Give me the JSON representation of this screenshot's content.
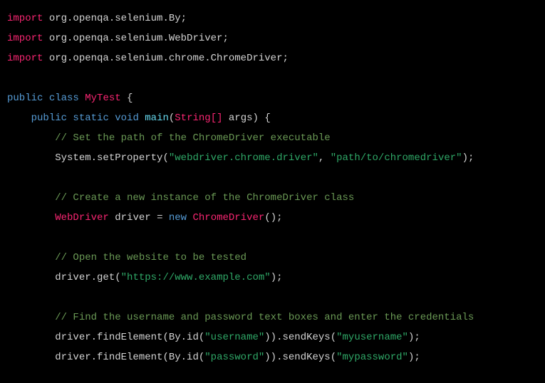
{
  "code": {
    "line1": {
      "import": "import",
      "pkg": " org.openqa.selenium.By;"
    },
    "line2": {
      "import": "import",
      "pkg": " org.openqa.selenium.WebDriver;"
    },
    "line3": {
      "import": "import",
      "pkg": " org.openqa.selenium.chrome.ChromeDriver;"
    },
    "line5": {
      "public": "public",
      "class": " class ",
      "name": "MyTest",
      "brace": " {"
    },
    "line6": {
      "indent": "    ",
      "public": "public",
      "static": " static",
      "void": " void ",
      "main": "main",
      "paren1": "(",
      "argtype": "String[]",
      "argname": " args",
      "paren2": ")",
      "brace": " {"
    },
    "line7": {
      "indent": "        ",
      "comment": "// Set the path of the ChromeDriver executable"
    },
    "line8": {
      "indent": "        ",
      "call": "System.setProperty(",
      "str1": "\"webdriver.chrome.driver\"",
      "comma": ", ",
      "str2": "\"path/to/chromedriver\"",
      "close": ");"
    },
    "line10": {
      "indent": "        ",
      "comment": "// Create a new instance of the ChromeDriver class"
    },
    "line11": {
      "indent": "        ",
      "type": "WebDriver",
      "var": " driver ",
      "eq": "=",
      "new": " new ",
      "ctor": "ChromeDriver",
      "paren": "();"
    },
    "line13": {
      "indent": "        ",
      "comment": "// Open the website to be tested"
    },
    "line14": {
      "indent": "        ",
      "call": "driver.get(",
      "str": "\"https://www.example.com\"",
      "close": ");"
    },
    "line16": {
      "indent": "        ",
      "comment": "// Find the username and password text boxes and enter the credentials"
    },
    "line17": {
      "indent": "        ",
      "p1": "driver.findElement(By.id(",
      "str1": "\"username\"",
      "p2": ")).sendKeys(",
      "str2": "\"myusername\"",
      "p3": ");"
    },
    "line18": {
      "indent": "        ",
      "p1": "driver.findElement(By.id(",
      "str1": "\"password\"",
      "p2": ")).sendKeys(",
      "str2": "\"mypassword\"",
      "p3": ");"
    }
  }
}
